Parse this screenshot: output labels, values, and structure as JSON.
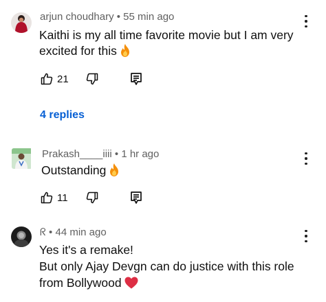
{
  "comments": [
    {
      "author": "arjun choudhary",
      "time": "55 min ago",
      "text_lines": [
        "Kaithi is my all time favorite movie but I am very",
        "excited for this"
      ],
      "emoji": "fire",
      "likes": "21",
      "replies_label": "4 replies"
    },
    {
      "author": "Prakash____iiii",
      "time": "1 hr ago",
      "text_lines": [
        "Outstanding"
      ],
      "emoji": "fire",
      "likes": "11"
    },
    {
      "author": "ᖇ",
      "time": "44 min ago",
      "text_lines": [
        "Yes it's a remake!",
        "But only Ajay Devgn can do justice with this role",
        "from Bollywood"
      ],
      "emoji": "red-heart"
    }
  ],
  "separator": " • ",
  "icons": {
    "like": "thumb-up-icon",
    "dislike": "thumb-down-icon",
    "reply": "reply-comment-icon",
    "more": "more-vert-icon"
  },
  "colors": {
    "text": "#0f0f0f",
    "meta": "#606060",
    "replies_link": "#065fd4",
    "fire": "#f4900c",
    "heart": "#dd2e44"
  }
}
